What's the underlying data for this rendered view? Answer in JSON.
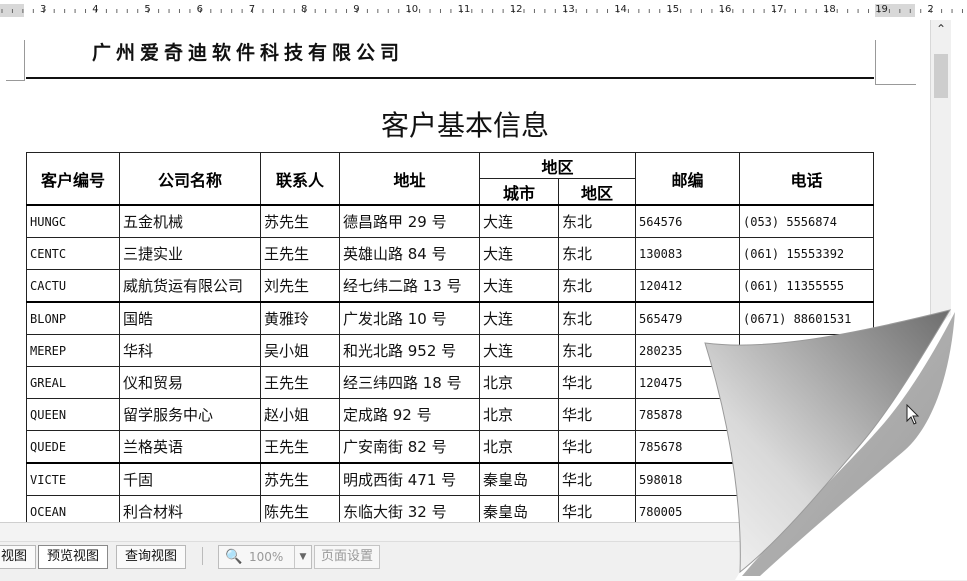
{
  "ruler": {
    "numbers": [
      "3",
      "4",
      "5",
      "6",
      "7",
      "8",
      "9",
      "10",
      "11",
      "12",
      "13",
      "14",
      "15",
      "16",
      "17",
      "18",
      "19",
      "2"
    ]
  },
  "document": {
    "company": "广州爱奇迪软件科技有限公司",
    "title": "客户基本信息",
    "headers": {
      "customer_id": "客户编号",
      "company_name": "公司名称",
      "contact": "联系人",
      "address": "地址",
      "region_group": "地区",
      "city": "城市",
      "region": "地区",
      "postcode": "邮编",
      "phone": "电话"
    },
    "rows": [
      {
        "id": "HUNGC",
        "company": "五金机械",
        "contact": "苏先生",
        "address": "德昌路甲 29 号",
        "city": "大连",
        "region": "东北",
        "postcode": "564576",
        "phone": "(053) 5556874"
      },
      {
        "id": "CENTC",
        "company": "三捷实业",
        "contact": "王先生",
        "address": "英雄山路 84 号",
        "city": "大连",
        "region": "东北",
        "postcode": "130083",
        "phone": "(061) 15553392"
      },
      {
        "id": "CACTU",
        "company": "威航货运有限公司",
        "contact": "刘先生",
        "address": "经七纬二路 13 号",
        "city": "大连",
        "region": "东北",
        "postcode": "120412",
        "phone": "(061) 11355555"
      },
      {
        "id": "BLONP",
        "company": "国皓",
        "contact": "黄雅玲",
        "address": "广发北路 10 号",
        "city": "大连",
        "region": "东北",
        "postcode": "565479",
        "phone": "(0671) 88601531"
      },
      {
        "id": "MEREP",
        "company": "华科",
        "contact": "吴小姐",
        "address": "和光北路 952 号",
        "city": "大连",
        "region": "东北",
        "postcode": "280235",
        "phone": ""
      },
      {
        "id": "GREAL",
        "company": "仪和贸易",
        "contact": "王先生",
        "address": "经三纬四路 18 号",
        "city": "北京",
        "region": "华北",
        "postcode": "120475",
        "phone": ""
      },
      {
        "id": "QUEEN",
        "company": "留学服务中心",
        "contact": "赵小姐",
        "address": "定成路 92 号",
        "city": "北京",
        "region": "华北",
        "postcode": "785878",
        "phone": ""
      },
      {
        "id": "QUEDE",
        "company": "兰格英语",
        "contact": "王先生",
        "address": "广安南街 82 号",
        "city": "北京",
        "region": "华北",
        "postcode": "785678",
        "phone": ""
      },
      {
        "id": "VICTE",
        "company": "千固",
        "contact": "苏先生",
        "address": "明成西街 471 号",
        "city": "秦皇岛",
        "region": "华北",
        "postcode": "598018",
        "phone": ""
      },
      {
        "id": "OCEAN",
        "company": "利合材料",
        "contact": "陈先生",
        "address": "东临大街 32 号",
        "city": "秦皇岛",
        "region": "华北",
        "postcode": "780005",
        "phone": ""
      }
    ]
  },
  "statusbar": {
    "view_design": "视图",
    "view_preview": "预览视图",
    "view_query": "查询视图",
    "zoom": "100%",
    "page_setup": "页面设置"
  },
  "icons": {
    "scroll_up": "chevron-up-icon",
    "zoom": "magnifier-icon",
    "dropdown": "chevron-down-icon",
    "cursor": "arrow-cursor-icon"
  }
}
